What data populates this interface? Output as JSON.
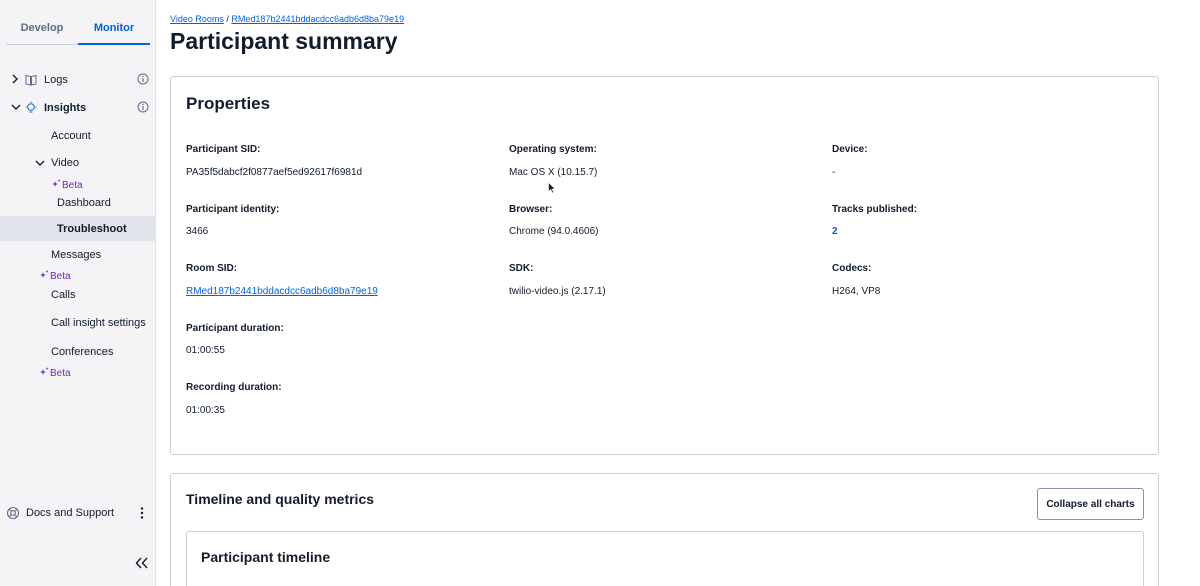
{
  "sidebar": {
    "tabs": [
      {
        "label": "Develop"
      },
      {
        "label": "Monitor"
      }
    ],
    "logs": {
      "label": "Logs"
    },
    "insights": {
      "label": "Insights"
    },
    "items": {
      "account": "Account",
      "video": "Video",
      "beta1": "Beta",
      "dashboard": "Dashboard",
      "troubleshoot": "Troubleshoot",
      "messages": "Messages",
      "beta2": "Beta",
      "calls": "Calls",
      "call_insight_settings": "Call insight settings",
      "conferences": "Conferences",
      "beta3": "Beta"
    },
    "docs": "Docs and Support"
  },
  "breadcrumb": {
    "root": "Video Rooms",
    "separator": "/",
    "current": "RMed187b2441bddacdcc6adb6d8ba79e19"
  },
  "page": {
    "title": "Participant summary"
  },
  "properties": {
    "title": "Properties",
    "participant_sid": {
      "label": "Participant SID:",
      "value": "PA35f5dabcf2f0877aef5ed92617f6981d"
    },
    "operating_system": {
      "label": "Operating system:",
      "value": "Mac OS X (10.15.7)"
    },
    "device": {
      "label": "Device:",
      "value": "-"
    },
    "participant_identity": {
      "label": "Participant identity:",
      "value": "3466"
    },
    "browser": {
      "label": "Browser:",
      "value": "Chrome (94.0.4606)"
    },
    "tracks_published": {
      "label": "Tracks published:",
      "value": "2"
    },
    "room_sid": {
      "label": "Room SID:",
      "value": "RMed187b2441bddacdcc6adb6d8ba79e19"
    },
    "sdk": {
      "label": "SDK:",
      "value": "twilio-video.js (2.17.1)"
    },
    "codecs": {
      "label": "Codecs:",
      "value": "H264, VP8"
    },
    "participant_duration": {
      "label": "Participant duration:",
      "value": "01:00:55"
    },
    "recording_duration": {
      "label": "Recording duration:",
      "value": "01:00:35"
    }
  },
  "timeline": {
    "title": "Timeline and quality metrics",
    "collapse_button": "Collapse all charts",
    "participant_timeline": "Participant timeline"
  },
  "colors": {
    "accent": "#0263e0",
    "beta": "#7125c5",
    "sidebar_bg": "#f4f4f6"
  }
}
